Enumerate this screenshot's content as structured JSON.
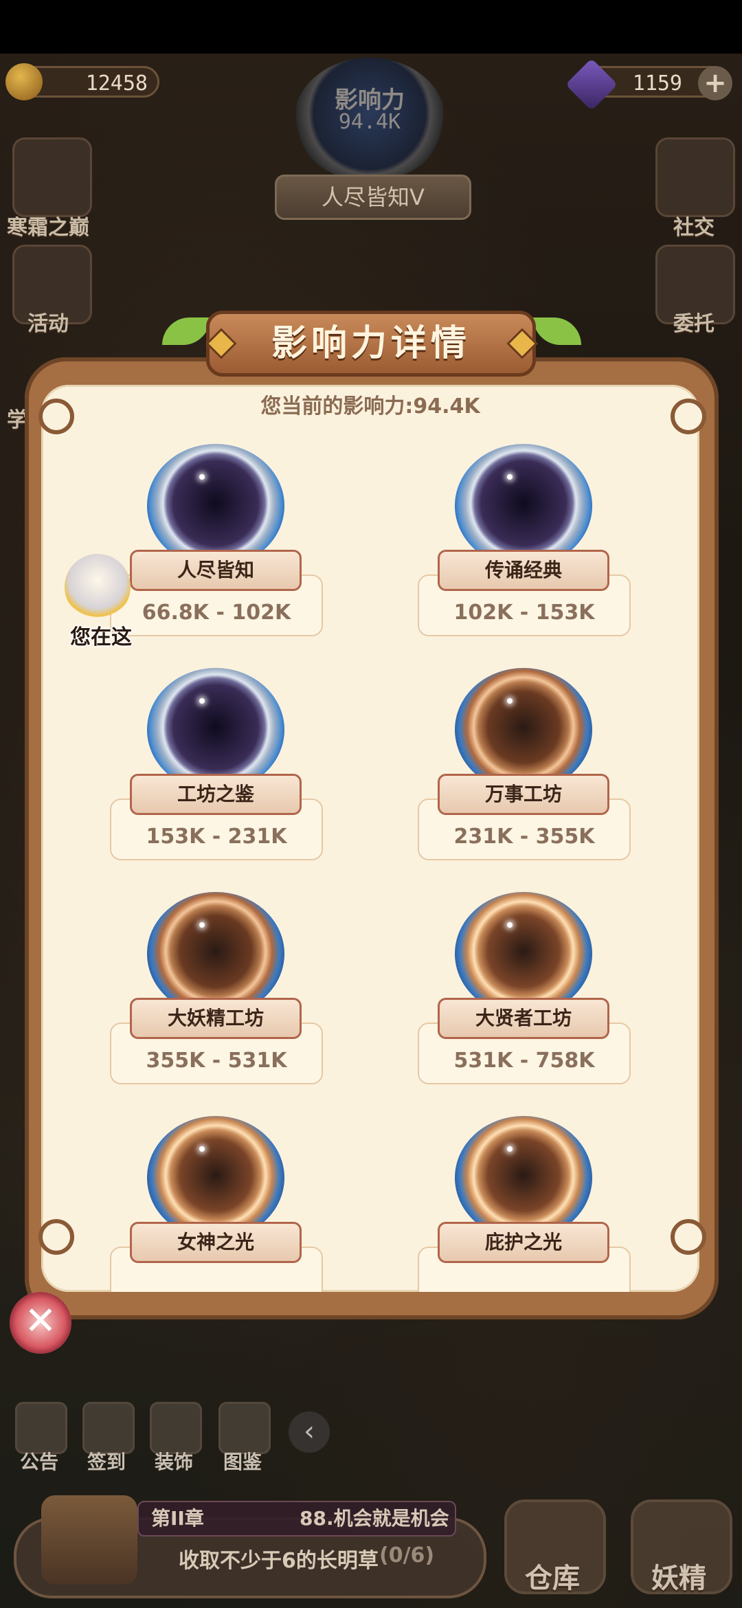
{
  "hud": {
    "coins": "12458",
    "gems": "1159",
    "influence_label": "影响力",
    "influence_value": "94.4K",
    "rank_title": "人尽皆知V",
    "plus": "+"
  },
  "side_left": [
    {
      "label": "寒霜之巅",
      "icon": "ice-crystal-icon"
    },
    {
      "label": "活动",
      "icon": "event-icon"
    },
    {
      "label": "学",
      "icon": "study-icon"
    }
  ],
  "side_right": [
    {
      "label": "社交",
      "icon": "social-icon"
    },
    {
      "label": "委托",
      "icon": "commission-icon"
    }
  ],
  "dialog": {
    "title": "影响力详情",
    "subtitle": "您当前的影响力:94.4K",
    "you_here": "您在这",
    "close": "✕",
    "ranks": [
      {
        "name": "人尽皆知",
        "range": "66.8K - 102K",
        "tier": "silver"
      },
      {
        "name": "传诵经典",
        "range": "102K - 153K",
        "tier": "silver"
      },
      {
        "name": "工坊之鉴",
        "range": "153K - 231K",
        "tier": "silver"
      },
      {
        "name": "万事工坊",
        "range": "231K - 355K",
        "tier": "bronze"
      },
      {
        "name": "大妖精工坊",
        "range": "355K - 531K",
        "tier": "bronze"
      },
      {
        "name": "大贤者工坊",
        "range": "531K - 758K",
        "tier": "gold"
      },
      {
        "name": "女神之光",
        "range": "",
        "tier": "gold"
      },
      {
        "name": "庇护之光",
        "range": "",
        "tier": "gold"
      }
    ]
  },
  "bottom_menu": [
    {
      "label": "公告",
      "icon": "notice-icon"
    },
    {
      "label": "签到",
      "icon": "checkin-icon"
    },
    {
      "label": "装饰",
      "icon": "decor-icon"
    },
    {
      "label": "图鉴",
      "icon": "codex-icon"
    }
  ],
  "quest": {
    "chapter": "第II章",
    "chapter_title": "88.机会就是机会",
    "text": "收取不少于6的长明草",
    "progress": "(0/6)"
  },
  "bottom_big": [
    {
      "label": "仓库",
      "icon": "warehouse-icon"
    },
    {
      "label": "妖精",
      "icon": "fairy-icon"
    }
  ]
}
